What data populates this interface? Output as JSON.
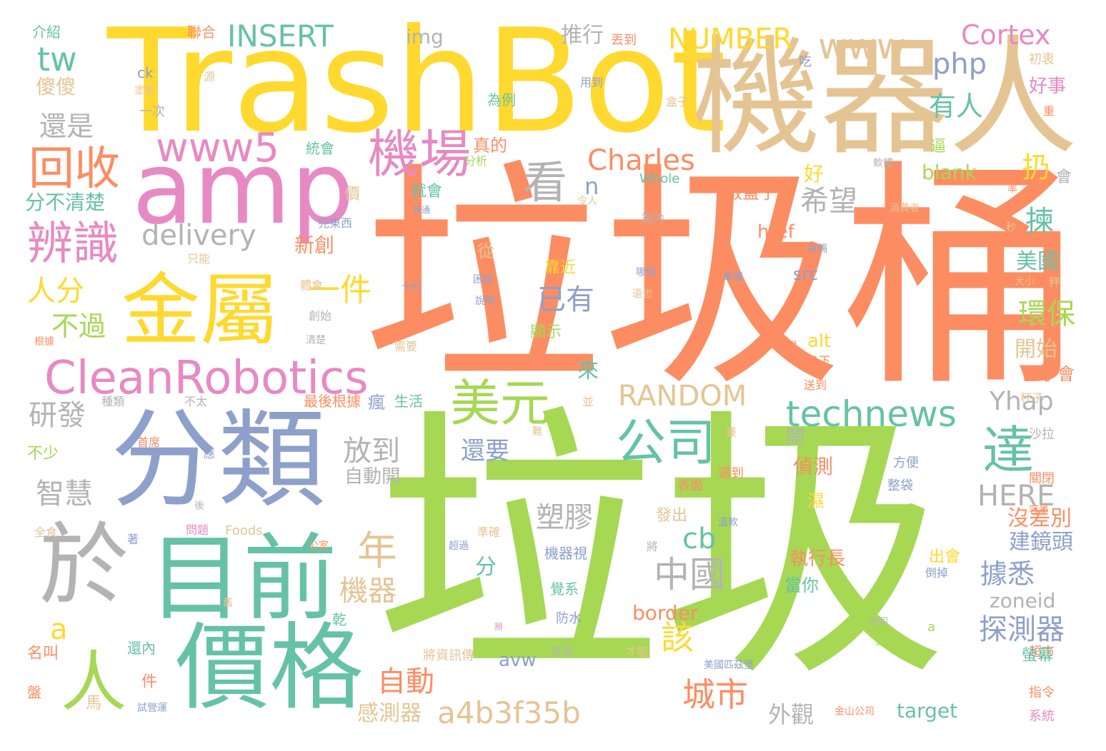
{
  "palette": {
    "green": "#a6d854",
    "orange": "#fc8d62",
    "yellow": "#ffd92f",
    "tan": "#e5c494",
    "blue": "#8da0cb",
    "pink": "#e78ac3",
    "teal": "#66c2a5",
    "grey": "#b3b3b3"
  },
  "words": [
    "垃圾",
    "垃圾桶",
    "TrashBot",
    "機器人",
    "amp",
    "分類",
    "目前",
    "價格",
    "金屬",
    "於",
    "CleanRobotics",
    "回收",
    "辨識",
    "人",
    "機場",
    "美元",
    "公司",
    "達",
    "technews",
    "www5",
    "www",
    "看",
    "Charles",
    "delivery",
    "RANDOM",
    "Yhap",
    "中國",
    "年",
    "INSERT",
    "NUMBER",
    "Cortex",
    "tw",
    "php",
    "a4b3f35b",
    "城市",
    "自動",
    "該",
    "HERE",
    "有人",
    "放到",
    "智慧",
    "研發",
    "塑膠",
    "機器",
    "一件",
    "人分",
    "不過",
    "還是",
    "希望",
    "已有",
    "環保",
    "探測器",
    "還要",
    "據悉",
    "cb",
    "感測器",
    "外觀",
    "target",
    "src",
    "href",
    "blank",
    "alt",
    "avw",
    "border",
    "zoneid",
    "img",
    "推行",
    "好事",
    "扔",
    "揀",
    "美國",
    "開始",
    "蓋子會",
    "建鏡頭",
    "沒差別",
    "執行長",
    "偵測",
    "開",
    "自動開",
    "新創",
    "分不清楚",
    "傻傻",
    "介紹",
    "聯合",
    "丟到",
    "吃",
    "初衷",
    "一次",
    "統會",
    "為例",
    "用到",
    "盒子",
    "真的",
    "分析",
    "好",
    "啟蓋子",
    "會",
    "Whole",
    "Foods",
    "生活",
    "超市",
    "系統",
    "指令",
    "美國匹茲堡",
    "金山公司",
    "試營運",
    "最後根據",
    "種類",
    "首席",
    "不少",
    "全食",
    "名叫",
    "盤",
    "馬",
    "件",
    "還內",
    "乾",
    "瘋",
    "發出",
    "機器視",
    "覺系",
    "防水",
    "有液",
    "將資訊傳",
    "才能",
    "不同",
    "對",
    "倒掉",
    "表面",
    "遇到",
    "溫軟",
    "整袋",
    "方便",
    "關閉",
    "容量",
    "沙拉",
    "杯子",
    "叉子",
    "很",
    "扔下",
    "送到",
    "需要",
    "清楚",
    "創始",
    "根據",
    "體會",
    "只能",
    "完東西",
    "箱內",
    "哪個",
    "還也",
    "困惑",
    "說明",
    "十分",
    "單價",
    "上",
    "大小",
    "秤",
    "秒",
    "率",
    "消費者",
    "每隔",
    "軟體",
    "重",
    "逼",
    "靠近",
    "顯示",
    "就會",
    "從",
    "分",
    "出會",
    "當你",
    "濕",
    "螢幕",
    "n",
    "a",
    "價",
    "問題",
    "來",
    "源",
    "a",
    "ck",
    "塗層",
    "普通",
    "令人",
    "兼",
    "並",
    "難",
    "將",
    "公室",
    "超過",
    "準確",
    "舊",
    "著",
    "後",
    "應",
    "不太",
    "掰"
  ]
}
